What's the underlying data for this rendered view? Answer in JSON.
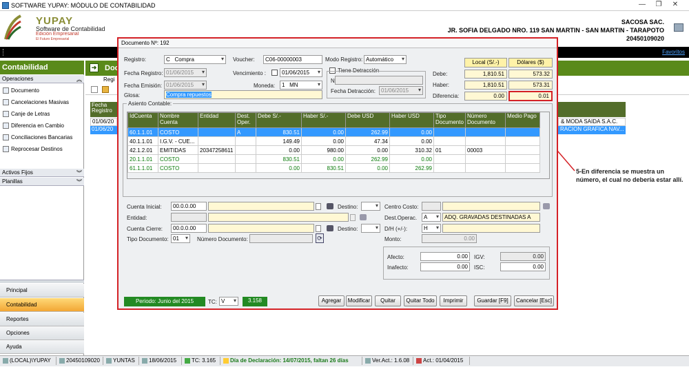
{
  "window": {
    "title": "SOFTWARE YUPAY: MÓDULO DE CONTABILIDAD"
  },
  "logo": {
    "name": "YUPAY",
    "subtitle": "Software de Contabilidad",
    "edition": "Edición Empresarial",
    "tagline": "El Futuro Empresarial"
  },
  "company": {
    "name": "SACOSA SAC.",
    "address": "JR. SOFIA DELGADO NRO. 119 SAN MARTIN - SAN MARTIN - TARAPOTO",
    "ruc": "20450109020"
  },
  "favorites": "Favoritos",
  "leftnav": {
    "title": "Contabilidad",
    "operaciones": "Operaciones",
    "items": [
      "Documento",
      "Cancelaciones Masivas",
      "Canje de Letras",
      "Diferencia en Cambio",
      "Conciliaciones Bancarias",
      "Reprocesar Destinos"
    ],
    "sections": [
      "Activos Fijos",
      "Planillas"
    ],
    "bottom": [
      "Principal",
      "Contabilidad",
      "Reportes",
      "Opciones",
      "Ayuda"
    ]
  },
  "background": {
    "section_title": "Doc",
    "subtab": "Regi",
    "col_fecha": "Fecha Registro",
    "rows": [
      {
        "fecha": "01/06/20",
        "right": "& MODA SAIDA S.A.C."
      },
      {
        "fecha": "01/06/20",
        "right": "RACION GRAFICA NAV..."
      }
    ]
  },
  "dialog": {
    "title": "Documento Nº: 192",
    "registro_label": "Registro:",
    "registro_code": "C",
    "registro_value": "Compra",
    "voucher_label": "Voucher:",
    "voucher_value": "C06-00000003",
    "modo_label": "Modo Registro:",
    "modo_value": "Automático",
    "fecha_registro_label": "Fecha Registro:",
    "fecha_registro_value": "01/06/2015",
    "vencimiento_label": "Vencimiento  :",
    "vencimiento_value": "01/06/2015",
    "tiene_detraccion": "Tiene Detracción",
    "fecha_emision_label": "Fecha Emisión:",
    "fecha_emision_value": "01/06/2015",
    "moneda_label": "Moneda:",
    "moneda_code": "1",
    "moneda_value": "MN",
    "nro_label": "Nº :",
    "glosa_label": "Glosa:",
    "glosa_value": "Compra repuestos",
    "fecha_detraccion_label": "Fecha Detracción:",
    "fecha_detraccion_value": "01/06/2015",
    "summary": {
      "local_header": "Local (S/.-)",
      "dolares_header": "Dólares ($)",
      "rows": [
        {
          "label": "Debe:",
          "local": "1,810.51",
          "usd": "573.32"
        },
        {
          "label": "Haber:",
          "local": "1,810.51",
          "usd": "573.31"
        },
        {
          "label": "Diferencia:",
          "local": "0.00",
          "usd": "0.01"
        }
      ]
    },
    "asiento_label": "Asiento Contable:",
    "columns": [
      "IdCuenta",
      "Nombre Cuenta",
      "Entidad",
      "Dest. Oper.",
      "Debe S/.-",
      "Haber S/.-",
      "Debe USD",
      "Haber USD",
      "Tipo Documento",
      "Número Documento",
      "Medio Pago"
    ],
    "rows": [
      {
        "id": "60.1.1.01",
        "nombre": "COSTO",
        "entidad": "",
        "dest": "A",
        "debe": "830.51",
        "haber": "0.00",
        "debe_usd": "262.99",
        "haber_usd": "0.00",
        "tipo": "",
        "numero": "",
        "medio": "",
        "state": "selected"
      },
      {
        "id": "40.1.1.01",
        "nombre": "I.G.V. - CUE...",
        "entidad": "",
        "dest": "",
        "debe": "149.49",
        "haber": "0.00",
        "debe_usd": "47.34",
        "haber_usd": "0.00",
        "tipo": "",
        "numero": "",
        "medio": "",
        "state": ""
      },
      {
        "id": "42.1.2.01",
        "nombre": "EMITIDAS",
        "entidad": "20347258611",
        "dest": "",
        "debe": "0.00",
        "haber": "980.00",
        "debe_usd": "0.00",
        "haber_usd": "310.32",
        "tipo": "01",
        "numero": "00003",
        "medio": "",
        "state": ""
      },
      {
        "id": "20.1.1.01",
        "nombre": "COSTO",
        "entidad": "",
        "dest": "",
        "debe": "830.51",
        "haber": "0.00",
        "debe_usd": "262.99",
        "haber_usd": "0.00",
        "tipo": "",
        "numero": "",
        "medio": "",
        "state": "green"
      },
      {
        "id": "61.1.1.01",
        "nombre": "COSTO",
        "entidad": "",
        "dest": "",
        "debe": "0.00",
        "haber": "830.51",
        "debe_usd": "0.00",
        "haber_usd": "262.99",
        "tipo": "",
        "numero": "",
        "medio": "",
        "state": "green"
      }
    ],
    "cuenta_inicial_label": "Cuenta Inicial:",
    "cuenta_inicial_value": "00.0.0.00",
    "destino_label": "Destino:",
    "entidad_label": "Entidad:",
    "cuenta_cierre_label": "Cuenta Cierre:",
    "cuenta_cierre_value": "00.0.0.00",
    "tipo_doc_label": "Tipo Documento:",
    "tipo_doc_value": "01",
    "numero_doc_label": "Número Documento:",
    "centro_costo_label": "Centro Costo:",
    "dest_operac_label": "Dest.Operac.",
    "dest_operac_code": "A",
    "dest_operac_value": "ADQ. GRAVADAS DESTINADAS A",
    "dh_label": "D/H (+/-):",
    "dh_value": "H",
    "monto_label": "Monto:",
    "monto_value": "0.00",
    "afecto_label": "Afecto:",
    "afecto_value": "0.00",
    "inafecto_label": "Inafecto:",
    "inafecto_value": "0.00",
    "igv_label": "IGV:",
    "igv_value": "0.00",
    "isc_label": "ISC:",
    "isc_value": "0.00",
    "periodo": "Periodo: Junio del 2015",
    "tc_label": "TC:",
    "tc_code": "V",
    "tc_value": "3.158",
    "buttons": {
      "agregar": "Agregar",
      "modificar": "Modificar",
      "quitar": "Quitar",
      "quitar_todo": "Quitar Todo",
      "imprimir": "Imprimir",
      "guardar": "Guardar [F9]",
      "cancelar": "Cancelar [Esc]"
    }
  },
  "annotation": "5-En diferencia se muestra un número, el cual no debería estar allí.",
  "statusbar": [
    "(LOCAL)\\YUPAY",
    "20450109020",
    "YUNTAS",
    "18/06/2015",
    "TC: 3.165",
    "Día de Declaración: 14/07/2015, faltan 26 días",
    "Ver.Act.: 1.6.08",
    "Act.: 01/04/2015"
  ],
  "colors": {
    "accent_green": "#5a8a1a",
    "highlight_red": "#d42126",
    "selection_blue": "#3399ff"
  }
}
